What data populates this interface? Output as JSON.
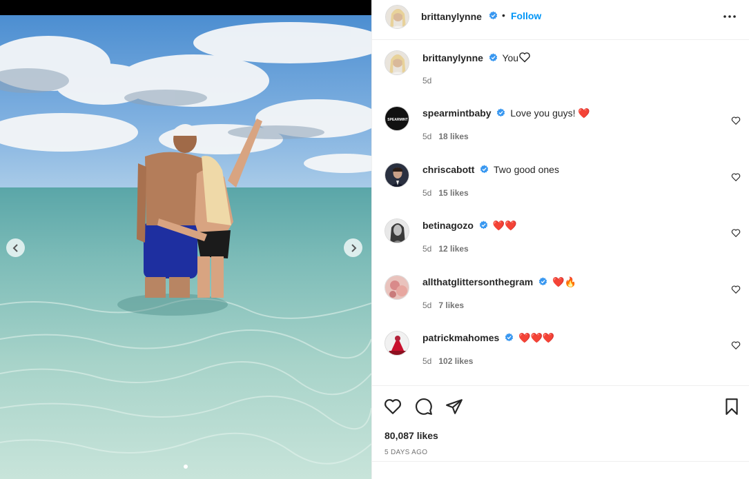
{
  "post": {
    "author": {
      "username": "brittanylynne",
      "verified": true,
      "separator": "•",
      "follow_label": "Follow"
    },
    "caption": {
      "username": "brittanylynne",
      "text": "You",
      "emoji": "white-heart-outline",
      "time": "5d"
    },
    "comments": [
      {
        "username": "spearmintbaby",
        "verified": true,
        "text": "Love you guys! ❤️",
        "time": "5d",
        "likes": "18 likes",
        "avatar": "spearmint-logo"
      },
      {
        "username": "chriscabott",
        "verified": true,
        "text": "Two good ones",
        "time": "5d",
        "likes": "15 likes",
        "avatar": "man-suit"
      },
      {
        "username": "betinagozo",
        "verified": true,
        "text": "❤️❤️",
        "time": "5d",
        "likes": "12 likes",
        "avatar": "woman-bw"
      },
      {
        "username": "allthatglittersonthegram",
        "verified": true,
        "text": "❤️🔥",
        "time": "5d",
        "likes": "7 likes",
        "avatar": "pink-photo"
      },
      {
        "username": "patrickmahomes",
        "verified": true,
        "text": "❤️❤️❤️",
        "time": "5d",
        "likes": "102 likes",
        "avatar": "red-action"
      }
    ],
    "like_count": "80,087 likes",
    "posted": "5 DAYS AGO",
    "avatar_logo_text": "SPEARMINT",
    "colors": {
      "follow_blue": "#0095f6",
      "verified_blue": "#3897f0",
      "heart_red": "#ed1c24",
      "text_primary": "#262626",
      "text_secondary": "#737373"
    },
    "carousel": {
      "slide_count": 2,
      "active_index": 1
    }
  }
}
